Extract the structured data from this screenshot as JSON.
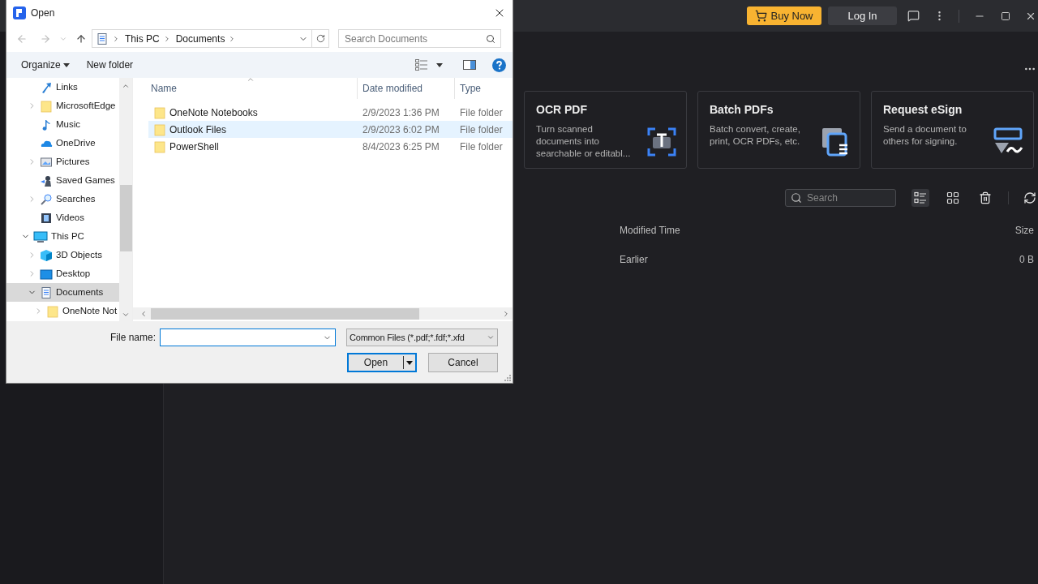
{
  "app": {
    "buy_button": "Buy Now",
    "login_button": "Log In",
    "tool_cards": [
      {
        "title": "OCR PDF",
        "description": "Turn scanned documents into searchable or editabl...",
        "kind": "ocr"
      },
      {
        "title": "Batch PDFs",
        "description": "Batch convert, create, print, OCR PDFs, etc.",
        "kind": "batch"
      },
      {
        "title": "Request eSign",
        "description": "Send a document to others for signing.",
        "kind": "esign"
      }
    ],
    "search_placeholder": "Search",
    "view_modes": [
      {
        "kind": "list",
        "selected": true
      },
      {
        "kind": "grid",
        "selected": false
      }
    ],
    "columns": [
      "Modified Time",
      "Size"
    ],
    "rows": [
      {
        "modified": "Earlier",
        "size": "0 B"
      }
    ]
  },
  "dialog": {
    "title": "Open",
    "breadcrumb": [
      "This PC",
      "Documents"
    ],
    "search_placeholder": "Search Documents",
    "organize_button": "Organize",
    "new_folder_button": "New folder",
    "nav_tree": [
      {
        "children": [
          {
            "label": "Links",
            "kind": "link",
            "selected": false
          },
          {
            "label": "MicrosoftEdge",
            "kind": "folder",
            "expanded": false,
            "selected": false
          },
          {
            "label": "Music",
            "kind": "music",
            "selected": false
          },
          {
            "label": "OneDrive",
            "kind": "cloud",
            "selected": false
          },
          {
            "label": "Pictures",
            "kind": "pictures",
            "expanded": false,
            "selected": false
          },
          {
            "label": "Saved Games",
            "kind": "games",
            "selected": false
          },
          {
            "label": "Searches",
            "kind": "search",
            "expanded": false,
            "selected": false
          },
          {
            "label": "Videos",
            "kind": "videos",
            "selected": false
          }
        ]
      },
      {
        "label": "This PC",
        "kind": "pc",
        "expanded": true,
        "selected": false,
        "children": [
          {
            "label": "3D Objects",
            "kind": "cube",
            "expanded": false,
            "selected": false
          },
          {
            "label": "Desktop",
            "kind": "desktop",
            "expanded": false,
            "selected": false
          },
          {
            "label": "Documents",
            "kind": "documents",
            "expanded": true,
            "selected": true,
            "children": [
              {
                "label": "OneNote Not",
                "kind": "folder",
                "expanded": false,
                "selected": false
              }
            ]
          }
        ]
      }
    ],
    "columns": [
      "Name",
      "Date modified",
      "Type"
    ],
    "files": [
      {
        "name": "OneNote Notebooks",
        "date": "2/9/2023 1:36 PM",
        "type": "File folder",
        "selected": false
      },
      {
        "name": "Outlook Files",
        "date": "2/9/2023 6:02 PM",
        "type": "File folder",
        "selected": true
      },
      {
        "name": "PowerShell",
        "date": "8/4/2023 6:25 PM",
        "type": "File folder",
        "selected": false
      }
    ],
    "file_name_label": "File name:",
    "file_type": "Common Files (*.pdf;*.fdf;*.xfd",
    "open_button": "Open",
    "cancel_button": "Cancel"
  }
}
